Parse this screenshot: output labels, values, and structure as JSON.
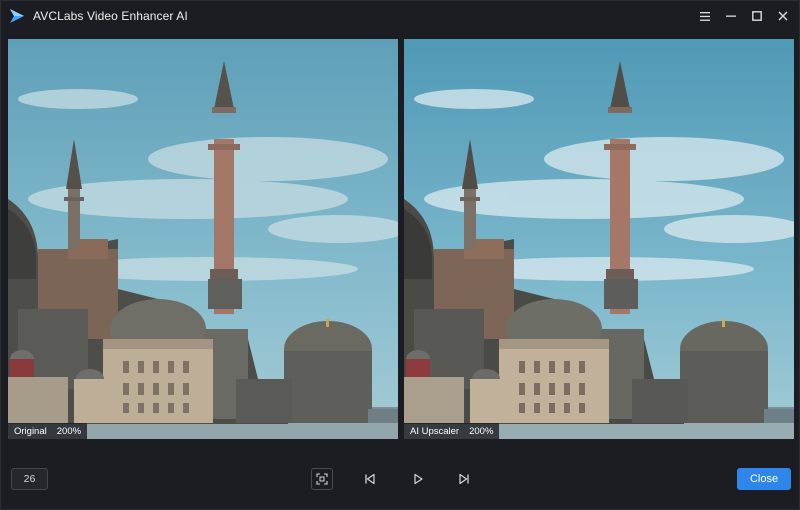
{
  "window": {
    "title": "AVCLabs Video Enhancer AI",
    "controls": [
      {
        "name": "menu-icon"
      },
      {
        "name": "minimize-icon"
      },
      {
        "name": "maximize-icon"
      },
      {
        "name": "close-icon"
      }
    ]
  },
  "preview": {
    "left": {
      "label": "Original",
      "zoom": "200%"
    },
    "right": {
      "label": "AI Upscaler",
      "zoom": "200%"
    }
  },
  "bottom": {
    "frame_number": "26",
    "close_label": "Close"
  },
  "colors": {
    "accent": "#2e86ea",
    "background": "#1c1d22"
  }
}
